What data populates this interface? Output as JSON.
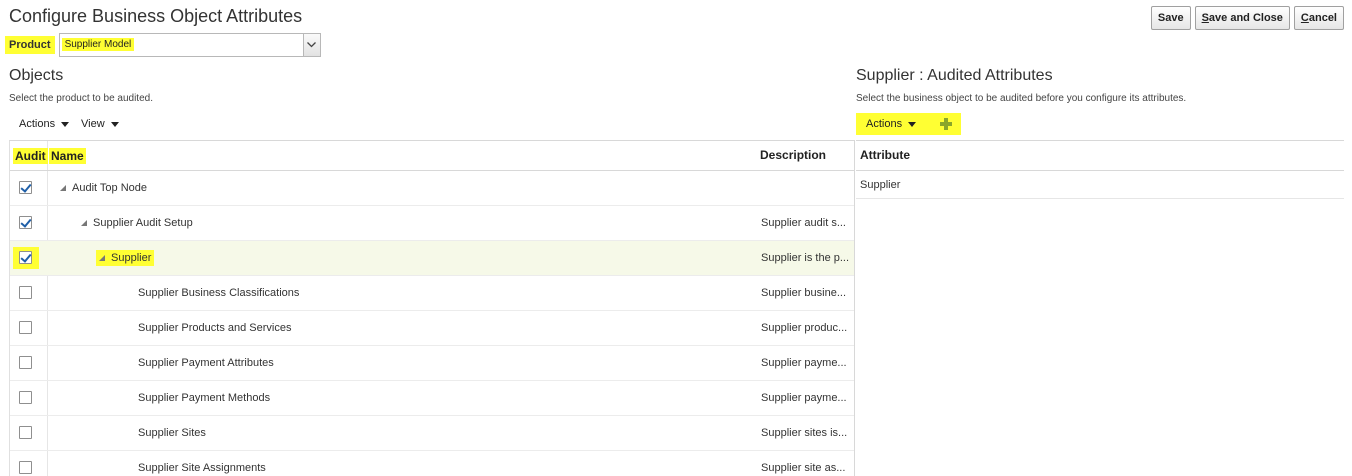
{
  "page": {
    "title": "Configure Business Object Attributes"
  },
  "buttons": {
    "save": "Save",
    "save_close_first": "S",
    "save_close_rest": "ave and Close",
    "cancel_first": "C",
    "cancel_rest": "ancel"
  },
  "product": {
    "label": "Product",
    "value": "Supplier Model"
  },
  "objects": {
    "title": "Objects",
    "subtitle": "Select the product to be audited.",
    "toolbar": {
      "actions": "Actions",
      "view": "View"
    },
    "columns": {
      "audit": "Audit",
      "name": "Name",
      "description": "Description"
    },
    "rows": [
      {
        "name": "Audit Top Node",
        "description": "",
        "checked": true
      },
      {
        "name": "Supplier Audit Setup",
        "description": "Supplier audit s...",
        "checked": true
      },
      {
        "name": "Supplier",
        "description": "Supplier is the p...",
        "checked": true
      },
      {
        "name": "Supplier Business Classifications",
        "description": "Supplier busine...",
        "checked": false
      },
      {
        "name": "Supplier Products and Services",
        "description": "Supplier produc...",
        "checked": false
      },
      {
        "name": "Supplier Payment Attributes",
        "description": "Supplier payme...",
        "checked": false
      },
      {
        "name": "Supplier Payment Methods",
        "description": "Supplier payme...",
        "checked": false
      },
      {
        "name": "Supplier Sites",
        "description": "Supplier sites is...",
        "checked": false
      },
      {
        "name": "Supplier Site Assignments",
        "description": "Supplier site as...",
        "checked": false
      }
    ]
  },
  "attributes": {
    "title": "Supplier : Audited Attributes",
    "subtitle": "Select the business object to be audited before you configure its attributes.",
    "toolbar": {
      "actions": "Actions"
    },
    "columns": {
      "attribute": "Attribute"
    },
    "rows": [
      {
        "attribute": "Supplier"
      }
    ]
  },
  "colors": {
    "highlight": "#ffff33",
    "checkbox_check": "#1f5fa8",
    "add_icon": "#8aa62a",
    "selected_row": "#f6f9e8"
  }
}
